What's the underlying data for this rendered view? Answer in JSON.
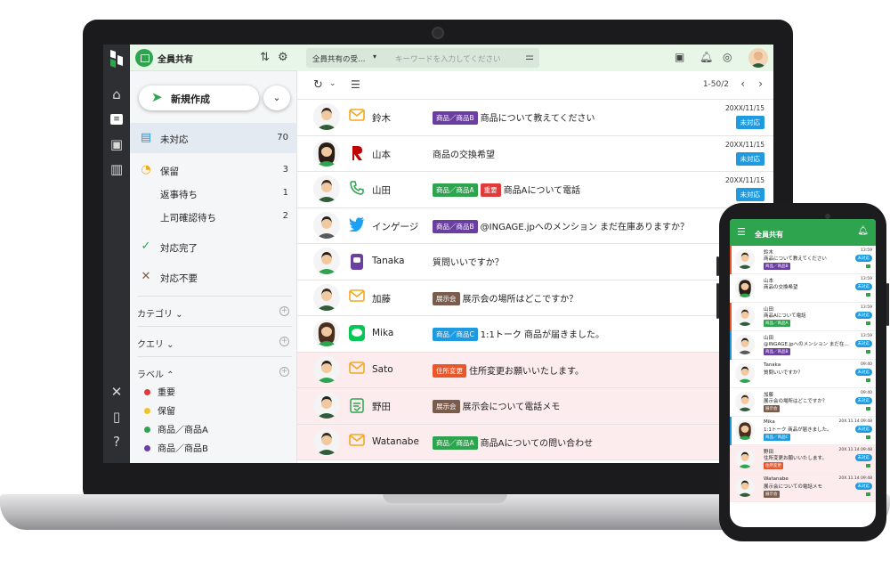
{
  "colors": {
    "brand_green": "#2ea44f",
    "status_blue": "#1e9be0",
    "pink_row": "#fdecee",
    "sidebar_dark": "#2e2f33"
  },
  "sidebar_panel": {
    "title": "全員共有",
    "new_button": "新規作成",
    "nav": [
      {
        "label": "未対応",
        "count": "70",
        "icon": "inbox-icon"
      },
      {
        "label": "保留",
        "count": "3",
        "icon": "clock-icon"
      },
      {
        "label": "返事待ち",
        "count": "1"
      },
      {
        "label": "上司確認待ち",
        "count": "2"
      },
      {
        "label": "対応完了",
        "icon": "check-icon"
      },
      {
        "label": "対応不要",
        "icon": "x-icon"
      }
    ],
    "sections": {
      "category": "カテゴリ",
      "query": "クエリ",
      "labels": "ラベル"
    },
    "labels": [
      {
        "name": "重要",
        "color": "#e03b3b"
      },
      {
        "name": "保留",
        "color": "#f2c12e"
      },
      {
        "name": "商品／商品A",
        "color": "#2ea44f"
      },
      {
        "name": "商品／商品B",
        "color": "#6b3fa0"
      }
    ]
  },
  "topbar": {
    "scope": "全員共有の受…",
    "search_placeholder": "キーワードを入力してください"
  },
  "list": {
    "pagination": "1-50/2",
    "rows": [
      {
        "name": "鈴木",
        "channel": "mail-icon",
        "tags": [
          {
            "t": "商品／商品B",
            "c": "#6b3fa0"
          }
        ],
        "subject": "商品について教えてください",
        "date": "20XX/11/15",
        "status": "未対応",
        "pink": false
      },
      {
        "name": "山本",
        "channel": "rakuten-icon",
        "tags": [],
        "subject": "商品の交換希望",
        "date": "20XX/11/15",
        "status": "未対応",
        "pink": false
      },
      {
        "name": "山田",
        "channel": "phone-icon",
        "tags": [
          {
            "t": "商品／商品A",
            "c": "#2ea44f"
          },
          {
            "t": "重要",
            "c": "#e03b3b"
          }
        ],
        "subject": "商品Aについて電話",
        "date": "20XX/11/15",
        "status": "未対応",
        "pink": false
      },
      {
        "name": "インゲージ",
        "channel": "twitter-icon",
        "tags": [
          {
            "t": "商品／商品B",
            "c": "#6b3fa0"
          }
        ],
        "subject": "@INGAGE.jpへのメンション まだ在庫ありますか？",
        "date": "",
        "status": "",
        "pink": false
      },
      {
        "name": "Tanaka",
        "channel": "chat-icon",
        "tags": [],
        "subject": "質問いいですか？",
        "date": "",
        "status": "",
        "pink": false
      },
      {
        "name": "加藤",
        "channel": "mail-icon",
        "tags": [
          {
            "t": "展示会",
            "c": "#7a5c4c"
          }
        ],
        "subject": "展示会の場所はどこですか？",
        "date": "",
        "status": "",
        "pink": false
      },
      {
        "name": "Mika",
        "channel": "line-icon",
        "tags": [
          {
            "t": "商品／商品C",
            "c": "#1e9be0"
          }
        ],
        "subject": "1:1トーク 商品が届きました。",
        "date": "",
        "status": "",
        "pink": false
      },
      {
        "name": "Sato",
        "channel": "mail-icon",
        "tags": [
          {
            "t": "住所変更",
            "c": "#e8562a"
          }
        ],
        "subject": "住所変更お願いいたします。",
        "date": "",
        "status": "",
        "pink": true
      },
      {
        "name": "野田",
        "channel": "memo-icon",
        "tags": [
          {
            "t": "展示会",
            "c": "#7a5c4c"
          }
        ],
        "subject": "展示会について電話メモ",
        "date": "",
        "status": "",
        "pink": true
      },
      {
        "name": "Watanabe",
        "channel": "mail-icon",
        "tags": [
          {
            "t": "商品／商品A",
            "c": "#2ea44f"
          }
        ],
        "subject": "商品Aについての問い合わせ",
        "date": "",
        "status": "",
        "pink": true
      }
    ]
  },
  "phone": {
    "title": "全員共有",
    "rows": [
      {
        "name": "鈴木",
        "subject": "商品について教えてください",
        "tag": "商品／商品B",
        "tagc": "#6b3fa0",
        "date": "13:59",
        "status": "未対応",
        "bar": "#e8562a",
        "pink": false
      },
      {
        "name": "山本",
        "subject": "商品の交換希望",
        "tag": "",
        "tagc": "",
        "date": "13:59",
        "status": "未対応",
        "bar": "",
        "pink": false
      },
      {
        "name": "山田",
        "subject": "商品Aについて電話",
        "tag": "商品／商品A",
        "tagc": "#2ea44f",
        "date": "13:59",
        "status": "未対応",
        "bar": "#e8562a",
        "pink": false
      },
      {
        "name": "山田",
        "subject": "@INGAGE.jpへのメンション まだ在…",
        "tag": "商品／商品B",
        "tagc": "#6b3fa0",
        "date": "13:59",
        "status": "未対応",
        "bar": "#1e9be0",
        "pink": false
      },
      {
        "name": "Tanaka",
        "subject": "質問いいですか？",
        "tag": "",
        "tagc": "",
        "date": "09:40",
        "status": "未対応",
        "bar": "",
        "pink": false
      },
      {
        "name": "加藤",
        "subject": "展示会の場所はどこですか？",
        "tag": "展示会",
        "tagc": "#7a5c4c",
        "date": "09:40",
        "status": "未対応",
        "bar": "",
        "pink": false
      },
      {
        "name": "Mika",
        "subject": "1:1トーク 商品が届きました。",
        "tag": "商品／商品C",
        "tagc": "#1e9be0",
        "date": "20X.11.14 09:48",
        "status": "未対応",
        "bar": "#1e9be0",
        "pink": false
      },
      {
        "name": "野田",
        "subject": "住所変更お願いいたします。",
        "tag": "住所変更",
        "tagc": "#e8562a",
        "date": "20X.11.14 09:48",
        "status": "未対応",
        "bar": "",
        "pink": true
      },
      {
        "name": "Watanabe",
        "subject": "展示会についての電話メモ",
        "tag": "展示会",
        "tagc": "#7a5c4c",
        "date": "20X.11.14 09:48",
        "status": "未対応",
        "bar": "",
        "pink": true
      }
    ]
  }
}
